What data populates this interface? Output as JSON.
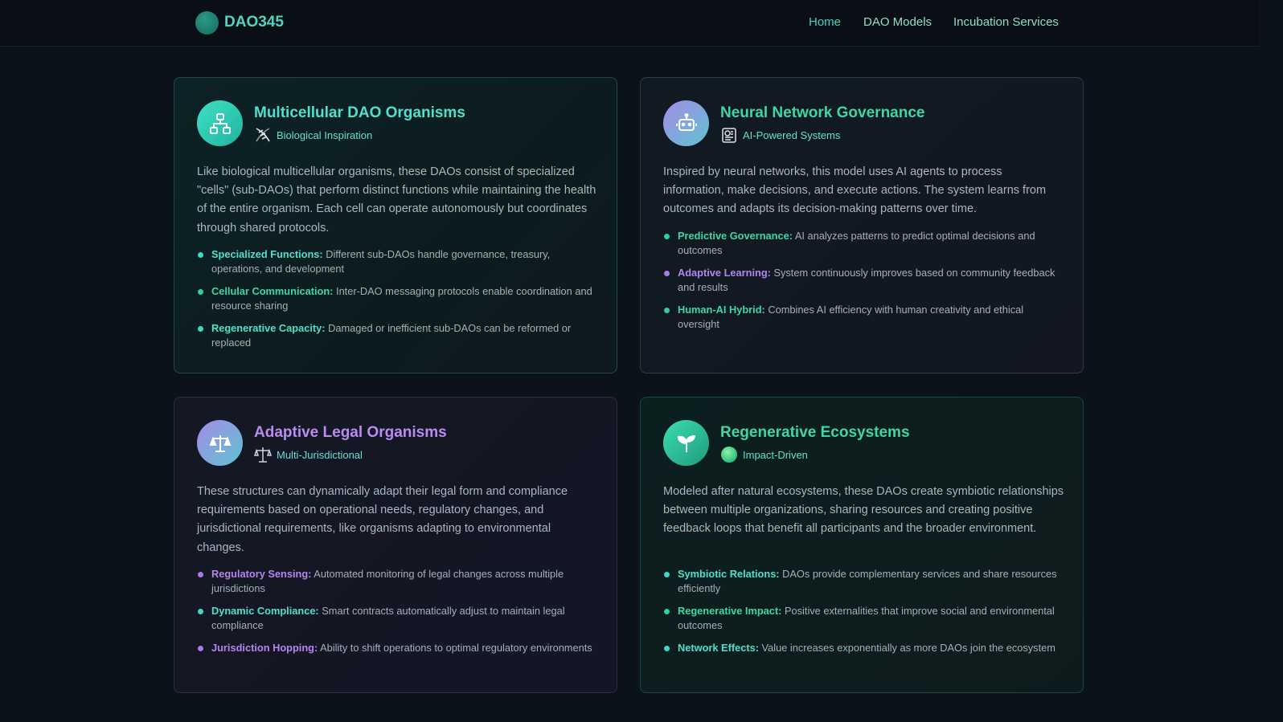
{
  "header": {
    "logo_text": "DAO345",
    "nav": [
      "Home",
      "DAO Models",
      "Incubation Services"
    ]
  },
  "cards": [
    {
      "title": "Multicellular DAO Organisms",
      "icon": "network-hierarchy-icon",
      "badge": "Biological Inspiration",
      "badge_icon": "dna-icon",
      "description": "Like biological multicellular organisms, these DAOs consist of specialized \"cells\" (sub-DAOs) that perform distinct functions while maintaining the health of the entire organism. Each cell can operate autonomously but coordinates through shared protocols.",
      "items": [
        {
          "key": "Specialized Functions:",
          "text": " Different sub-DAOs handle governance, treasury, operations, and development"
        },
        {
          "key": "Cellular Communication:",
          "text": " Inter-DAO messaging protocols enable coordination and resource sharing"
        },
        {
          "key": "Regenerative Capacity:",
          "text": " Damaged or inefficient sub-DAOs can be reformed or replaced"
        }
      ]
    },
    {
      "title": "Neural Network Governance",
      "icon": "robot-icon",
      "badge": "AI-Powered Systems",
      "badge_icon": "ai-chip-icon",
      "description": "Inspired by neural networks, this model uses AI agents to process information, make decisions, and execute actions. The system learns from outcomes and adapts its decision-making patterns over time.",
      "items": [
        {
          "key": "Predictive Governance:",
          "text": " AI analyzes patterns to predict optimal decisions and outcomes"
        },
        {
          "key": "Adaptive Learning:",
          "text": " System continuously improves based on community feedback and results"
        },
        {
          "key": "Human-AI Hybrid:",
          "text": " Combines AI efficiency with human creativity and ethical oversight"
        }
      ]
    },
    {
      "title": "Adaptive Legal Organisms",
      "icon": "scales-icon",
      "badge": "Multi-Jurisdictional",
      "badge_icon": "balance-scale-icon",
      "description": "These structures can dynamically adapt their legal form and compliance requirements based on operational needs, regulatory changes, and jurisdictional requirements, like organisms adapting to environmental changes.",
      "items": [
        {
          "key": "Regulatory Sensing:",
          "text": " Automated monitoring of legal changes across multiple jurisdictions"
        },
        {
          "key": "Dynamic Compliance:",
          "text": " Smart contracts automatically adjust to maintain legal compliance"
        },
        {
          "key": "Jurisdiction Hopping:",
          "text": " Ability to shift operations to optimal regulatory environments"
        }
      ]
    },
    {
      "title": "Regenerative Ecosystems",
      "icon": "sprout-icon",
      "badge": "Impact-Driven",
      "badge_icon": "green-globe-icon",
      "description": "Modeled after natural ecosystems, these DAOs create symbiotic relationships between multiple organizations, sharing resources and creating positive feedback loops that benefit all participants and the broader environment.",
      "items": [
        {
          "key": "Symbiotic Relations:",
          "text": " DAOs provide complementary services and share resources efficiently"
        },
        {
          "key": "Regenerative Impact:",
          "text": " Positive externalities that improve social and environmental outcomes"
        },
        {
          "key": "Network Effects:",
          "text": " Value increases exponentially as more DAOs join the ecosystem"
        }
      ]
    }
  ],
  "colors": {
    "teal": "#4fe0cb",
    "green": "#3ed7a6",
    "purple": "#b485ef",
    "background": "#0c121a"
  }
}
